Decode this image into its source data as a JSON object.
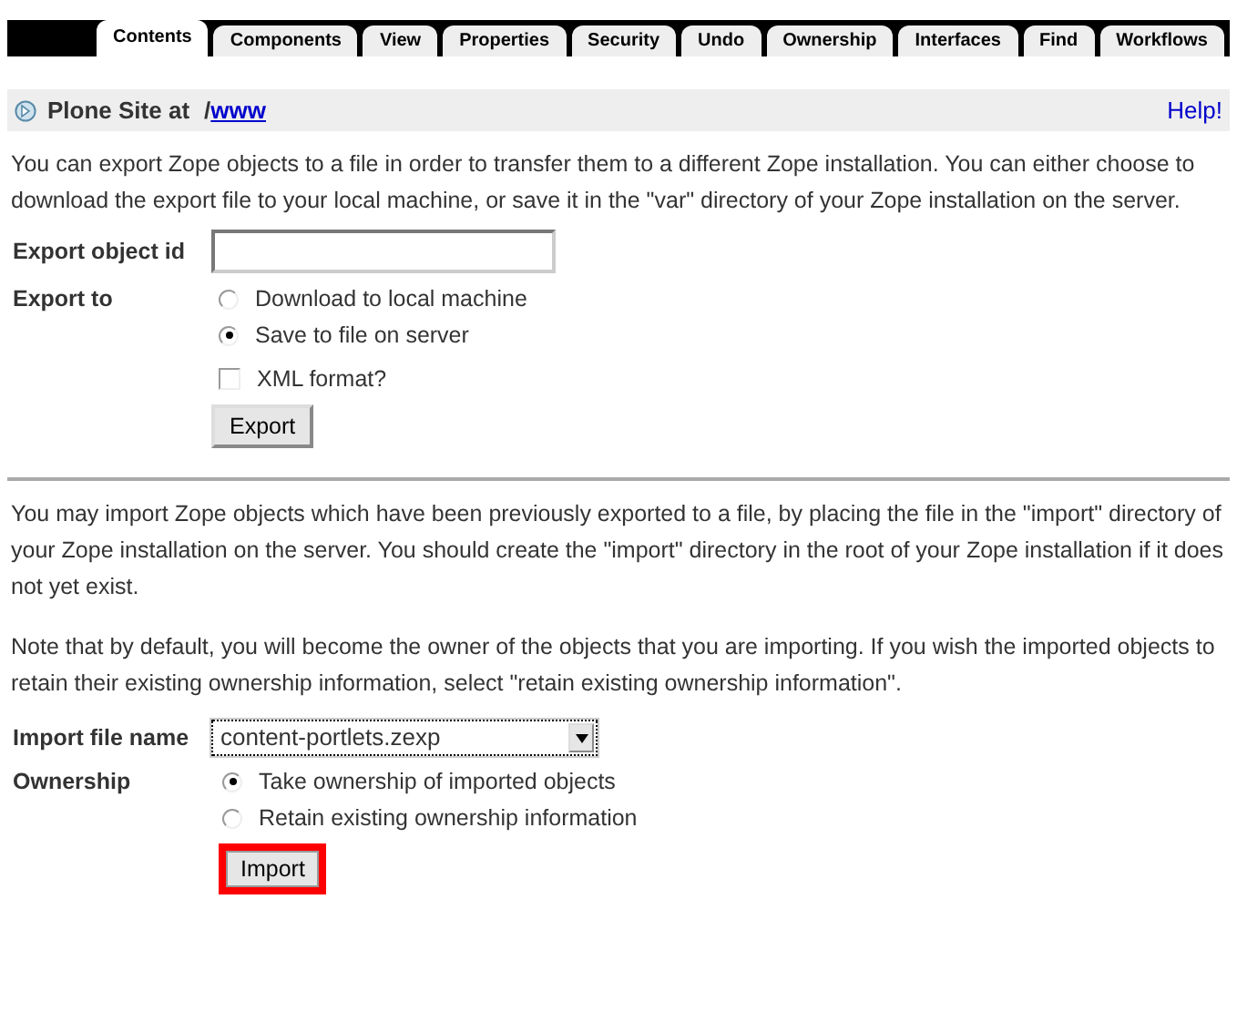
{
  "tabs": [
    {
      "label": "Contents",
      "selected": true
    },
    {
      "label": "Components",
      "selected": false
    },
    {
      "label": "View",
      "selected": false
    },
    {
      "label": "Properties",
      "selected": false
    },
    {
      "label": "Security",
      "selected": false
    },
    {
      "label": "Undo",
      "selected": false
    },
    {
      "label": "Ownership",
      "selected": false
    },
    {
      "label": "Interfaces",
      "selected": false
    },
    {
      "label": "Find",
      "selected": false
    },
    {
      "label": "Workflows",
      "selected": false
    }
  ],
  "header": {
    "title": "Plone Site at",
    "path_prefix": "/",
    "path_link": "www",
    "help": "Help!"
  },
  "export": {
    "intro": "You can export Zope objects to a file in order to transfer them to a different Zope installation. You can either choose to download the export file to your local machine, or save it in the \"var\" directory of your Zope installation on the server.",
    "id_label": "Export object id",
    "to_label": "Export to",
    "options": [
      {
        "label": "Download to local machine",
        "selected": false
      },
      {
        "label": "Save to file on server",
        "selected": true
      }
    ],
    "xml": {
      "label": "XML format?",
      "checked": false
    },
    "button": "Export"
  },
  "import": {
    "paragraphs": [
      "You may import Zope objects which have been previously exported to a file, by placing the file in the \"import\" directory of your Zope installation on the server. You should create the \"import\" directory in the root of your Zope installation if it does not yet exist.",
      "Note that by default, you will become the owner of the objects that you are importing. If you wish the imported objects to retain their existing ownership information, select \"retain existing ownership information\"."
    ],
    "file_label": "Import file name",
    "file_value": "content-portlets.zexp",
    "ownership_label": "Ownership",
    "options": [
      {
        "label": "Take ownership of imported objects",
        "selected": true
      },
      {
        "label": "Retain existing ownership information",
        "selected": false
      }
    ],
    "button": {
      "label": "Import",
      "highlighted": true
    }
  }
}
